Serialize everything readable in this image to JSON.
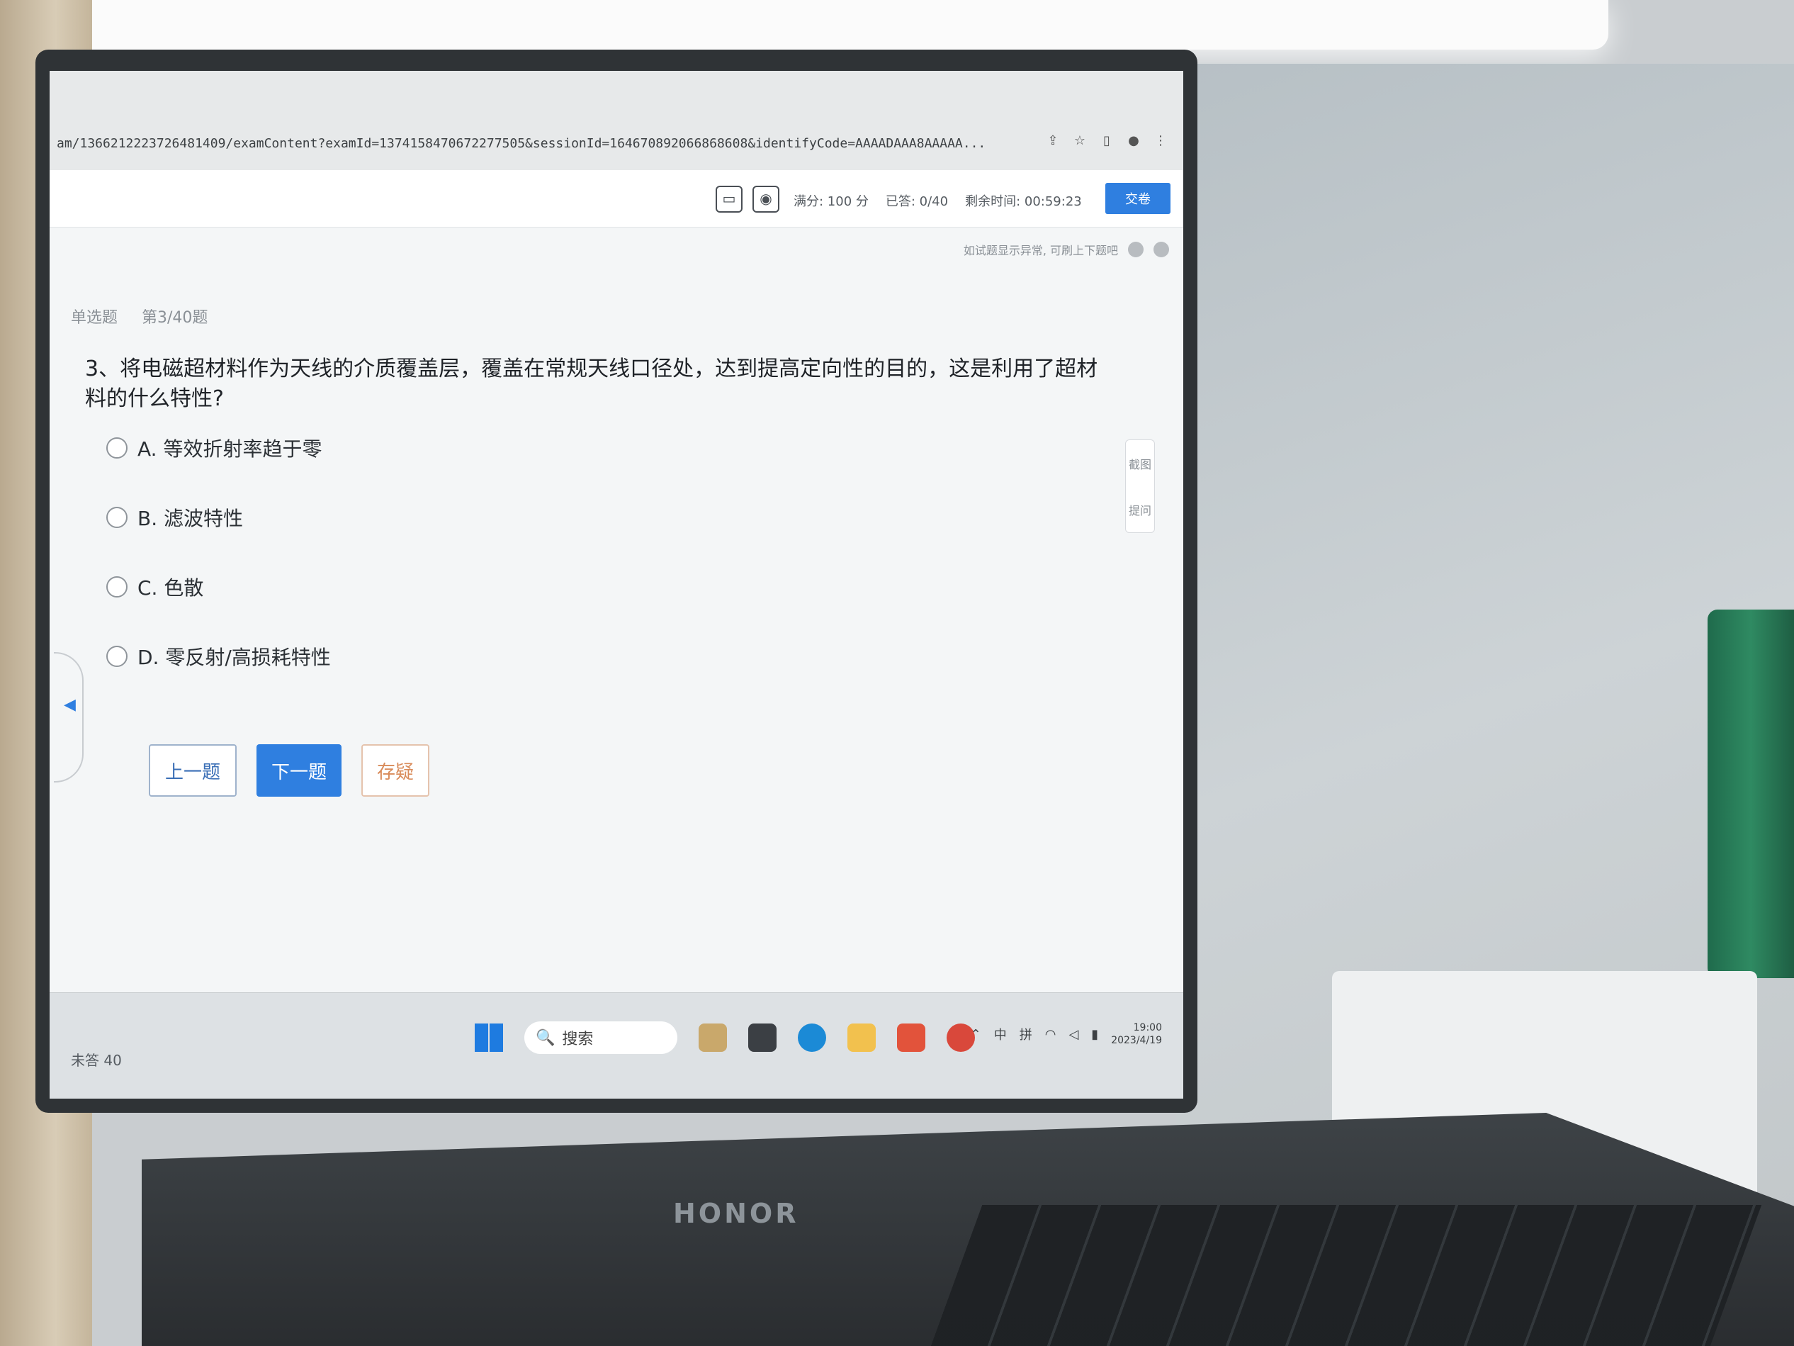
{
  "browser": {
    "url": "am/1366212223726481409/examContent?examId=1374158470672277505&sessionId=164670892066868608&identifyCode=AAAADAAA8AAAAA..."
  },
  "exam_header": {
    "score": "满分: 100 分",
    "answered": "已答: 0/40",
    "timer": "剩余时间: 00:59:23",
    "submit_label": "交卷"
  },
  "hint": {
    "text": "如试题显示异常, 可刷上下题吧"
  },
  "question": {
    "type": "单选题",
    "progress": "第3/40题",
    "text": "3、将电磁超材料作为天线的介质覆盖层，覆盖在常规天线口径处，达到提高定向性的目的，这是利用了超材料的什么特性?",
    "options": [
      {
        "label": "A. 等效折射率趋于零"
      },
      {
        "label": "B. 滤波特性"
      },
      {
        "label": "C. 色散"
      },
      {
        "label": "D. 零反射/高损耗特性"
      }
    ]
  },
  "nav": {
    "prev_label": "上一题",
    "next_label": "下一题",
    "mark_label": "存疑"
  },
  "side_tools": {
    "item1": "截图",
    "item2": "提问"
  },
  "footer": {
    "unanswered": "未答 40"
  },
  "taskbar": {
    "search_label": "搜索",
    "tray_lang1": "中",
    "tray_lang2": "拼",
    "time": "19:00",
    "date": "2023/4/19"
  },
  "laptop": {
    "brand": "HONOR"
  }
}
